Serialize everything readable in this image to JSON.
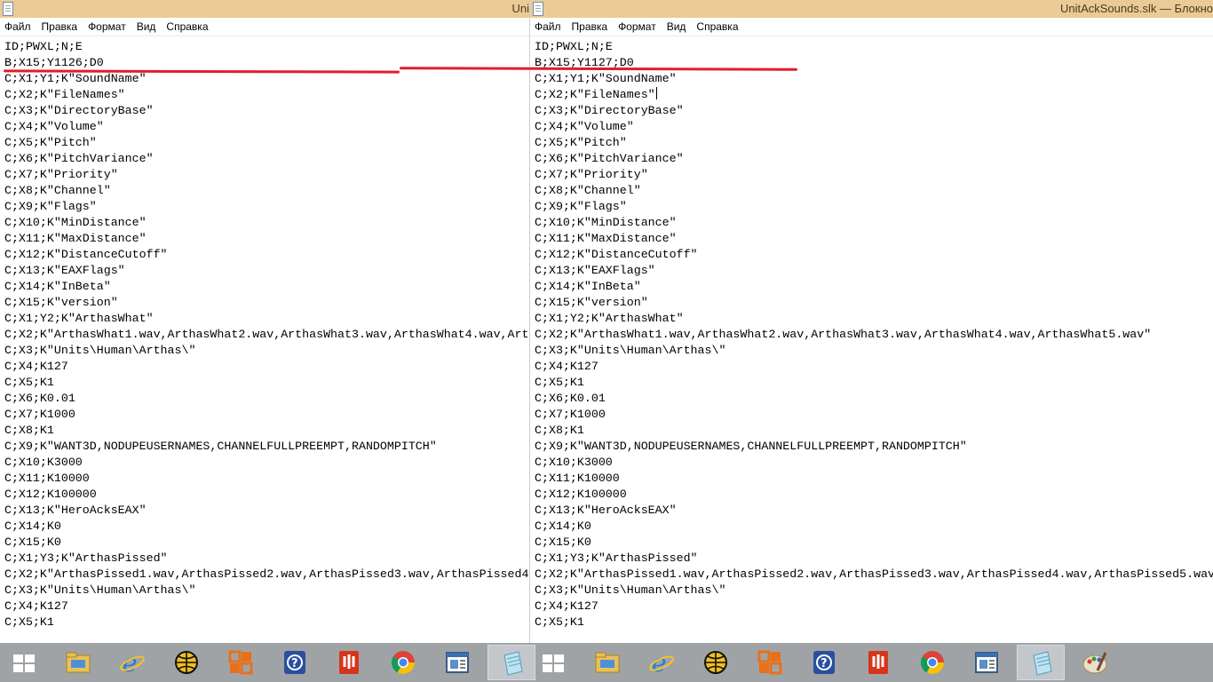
{
  "left_window": {
    "title": "Uni",
    "menu": [
      "Файл",
      "Правка",
      "Формат",
      "Вид",
      "Справка"
    ],
    "lines": [
      "ID;PWXL;N;E",
      "B;X15;Y1126;D0",
      "C;X1;Y1;K\"SoundName\"",
      "C;X2;K\"FileNames\"",
      "C;X3;K\"DirectoryBase\"",
      "C;X4;K\"Volume\"",
      "C;X5;K\"Pitch\"",
      "C;X6;K\"PitchVariance\"",
      "C;X7;K\"Priority\"",
      "C;X8;K\"Channel\"",
      "C;X9;K\"Flags\"",
      "C;X10;K\"MinDistance\"",
      "C;X11;K\"MaxDistance\"",
      "C;X12;K\"DistanceCutoff\"",
      "C;X13;K\"EAXFlags\"",
      "C;X14;K\"InBeta\"",
      "C;X15;K\"version\"",
      "C;X1;Y2;K\"ArthasWhat\"",
      "C;X2;K\"ArthasWhat1.wav,ArthasWhat2.wav,ArthasWhat3.wav,ArthasWhat4.wav,Art",
      "C;X3;K\"Units\\Human\\Arthas\\\"",
      "C;X4;K127",
      "C;X5;K1",
      "C;X6;K0.01",
      "C;X7;K1000",
      "C;X8;K1",
      "C;X9;K\"WANT3D,NODUPEUSERNAMES,CHANNELFULLPREEMPT,RANDOMPITCH\"",
      "C;X10;K3000",
      "C;X11;K10000",
      "C;X12;K100000",
      "C;X13;K\"HeroAcksEAX\"",
      "C;X14;K0",
      "C;X15;K0",
      "C;X1;Y3;K\"ArthasPissed\"",
      "C;X2;K\"ArthasPissed1.wav,ArthasPissed2.wav,ArthasPissed3.wav,ArthasPissed4",
      "C;X3;K\"Units\\Human\\Arthas\\\"",
      "C;X4;K127",
      "C;X5;K1"
    ]
  },
  "right_window": {
    "title": "UnitAckSounds.slk — Блокно",
    "menu": [
      "Файл",
      "Правка",
      "Формат",
      "Вид",
      "Справка"
    ],
    "lines": [
      "ID;PWXL;N;E",
      "B;X15;Y1127;D0",
      "C;X1;Y1;K\"SoundName\"",
      "C;X2;K\"FileNames\"",
      "C;X3;K\"DirectoryBase\"",
      "C;X4;K\"Volume\"",
      "C;X5;K\"Pitch\"",
      "C;X6;K\"PitchVariance\"",
      "C;X7;K\"Priority\"",
      "C;X8;K\"Channel\"",
      "C;X9;K\"Flags\"",
      "C;X10;K\"MinDistance\"",
      "C;X11;K\"MaxDistance\"",
      "C;X12;K\"DistanceCutoff\"",
      "C;X13;K\"EAXFlags\"",
      "C;X14;K\"InBeta\"",
      "C;X15;K\"version\"",
      "C;X1;Y2;K\"ArthasWhat\"",
      "C;X2;K\"ArthasWhat1.wav,ArthasWhat2.wav,ArthasWhat3.wav,ArthasWhat4.wav,ArthasWhat5.wav\"",
      "C;X3;K\"Units\\Human\\Arthas\\\"",
      "C;X4;K127",
      "C;X5;K1",
      "C;X6;K0.01",
      "C;X7;K1000",
      "C;X8;K1",
      "C;X9;K\"WANT3D,NODUPEUSERNAMES,CHANNELFULLPREEMPT,RANDOMPITCH\"",
      "C;X10;K3000",
      "C;X11;K10000",
      "C;X12;K100000",
      "C;X13;K\"HeroAcksEAX\"",
      "C;X14;K0",
      "C;X15;K0",
      "C;X1;Y3;K\"ArthasPissed\"",
      "C;X2;K\"ArthasPissed1.wav,ArthasPissed2.wav,ArthasPissed3.wav,ArthasPissed4.wav,ArthasPissed5.wav\"",
      "C;X3;K\"Units\\Human\\Arthas\\\"",
      "C;X4;K127",
      "C;X5;K1"
    ]
  },
  "taskbar": {
    "left_items": [
      "start-icon",
      "file-explorer-icon",
      "internet-explorer-icon",
      "globe-app-icon",
      "office-app-icon",
      "help-icon",
      "pdf-reader-icon",
      "chrome-icon",
      "window-app-icon",
      "notepad-icon"
    ],
    "right_items": [
      "start-icon",
      "file-explorer-icon",
      "internet-explorer-icon",
      "globe-app-icon",
      "office-app-icon",
      "help-icon",
      "pdf-reader-icon",
      "chrome-icon",
      "window-app-icon",
      "notepad-icon",
      "paint-icon"
    ]
  },
  "colors": {
    "titlebar": "#eacb95",
    "taskbar": "#a0a3a6",
    "annotation": "#e01e2a"
  }
}
